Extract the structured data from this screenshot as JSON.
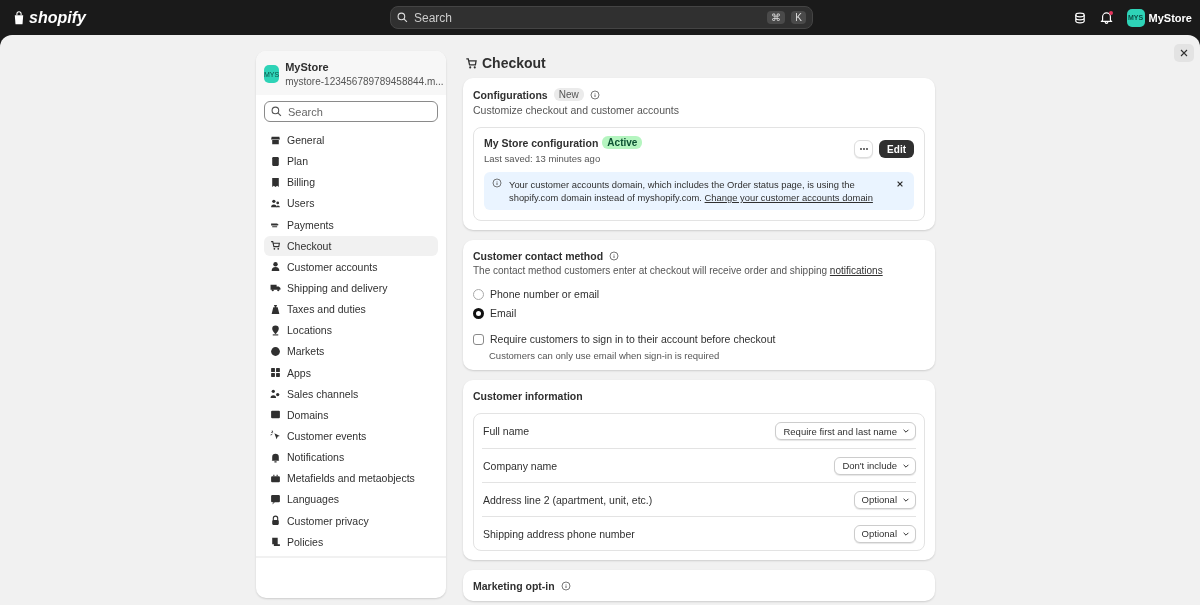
{
  "topbar": {
    "logo": "shopify",
    "search_placeholder": "Search",
    "shortcut_keys": [
      "⌘",
      "K"
    ],
    "store_avatar": "MYS",
    "store_name": "MyStore"
  },
  "sidebar": {
    "store": {
      "avatar": "MYS",
      "name": "MyStore",
      "domain": "mystore-123456789789458844.m..."
    },
    "search_placeholder": "Search",
    "items": [
      {
        "label": "General",
        "selected": false
      },
      {
        "label": "Plan",
        "selected": false
      },
      {
        "label": "Billing",
        "selected": false
      },
      {
        "label": "Users",
        "selected": false
      },
      {
        "label": "Payments",
        "selected": false
      },
      {
        "label": "Checkout",
        "selected": true
      },
      {
        "label": "Customer accounts",
        "selected": false
      },
      {
        "label": "Shipping and delivery",
        "selected": false
      },
      {
        "label": "Taxes and duties",
        "selected": false
      },
      {
        "label": "Locations",
        "selected": false
      },
      {
        "label": "Markets",
        "selected": false
      },
      {
        "label": "Apps",
        "selected": false
      },
      {
        "label": "Sales channels",
        "selected": false
      },
      {
        "label": "Domains",
        "selected": false
      },
      {
        "label": "Customer events",
        "selected": false
      },
      {
        "label": "Notifications",
        "selected": false
      },
      {
        "label": "Metafields and metaobjects",
        "selected": false
      },
      {
        "label": "Languages",
        "selected": false
      },
      {
        "label": "Customer privacy",
        "selected": false
      },
      {
        "label": "Policies",
        "selected": false
      }
    ]
  },
  "page": {
    "title": "Checkout"
  },
  "configurations": {
    "title": "Configurations",
    "badge": "New",
    "subtitle": "Customize checkout and customer accounts",
    "config": {
      "name": "My Store configuration",
      "status": "Active",
      "last_saved": "Last saved: 13 minutes ago",
      "edit": "Edit"
    },
    "banner": {
      "text": "Your customer accounts domain, which includes the Order status page, is using the shopify.com domain instead of myshopify.com.",
      "link": "Change your customer accounts domain"
    }
  },
  "contact_method": {
    "title": "Customer contact method",
    "description": "The contact method customers enter at checkout will receive order and shipping",
    "link": "notifications",
    "options": [
      {
        "label": "Phone number or email",
        "selected": false
      },
      {
        "label": "Email",
        "selected": true
      }
    ],
    "require_signin": {
      "label": "Require customers to sign in to their account before checkout",
      "checked": false,
      "help": "Customers can only use email when sign-in is required"
    }
  },
  "customer_information": {
    "title": "Customer information",
    "rows": [
      {
        "label": "Full name",
        "value": "Require first and last name"
      },
      {
        "label": "Company name",
        "value": "Don't include"
      },
      {
        "label": "Address line 2 (apartment, unit, etc.)",
        "value": "Optional"
      },
      {
        "label": "Shipping address phone number",
        "value": "Optional"
      }
    ]
  },
  "marketing": {
    "title": "Marketing opt-in"
  }
}
